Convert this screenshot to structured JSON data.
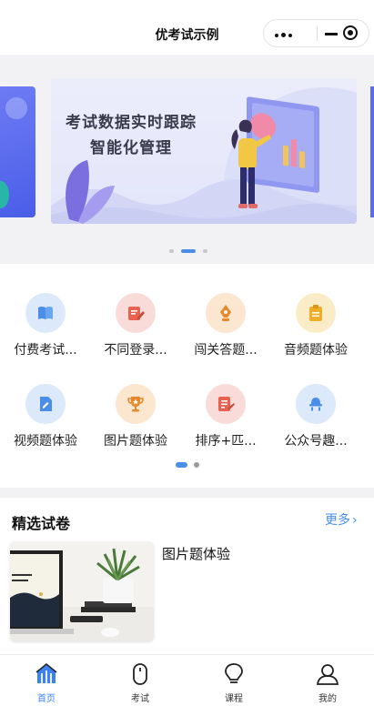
{
  "nav": {
    "title": "优考试示例"
  },
  "banner": {
    "line1": "考试数据实时跟踪",
    "line2": "智能化管理",
    "slides": 3,
    "active_slide": 1
  },
  "features": [
    {
      "label": "付费考试...",
      "icon": "book-icon",
      "color": "#dbe9fb",
      "accent": "#4a8ee8"
    },
    {
      "label": "不同登录...",
      "icon": "edit-icon",
      "color": "#f9dcda",
      "accent": "#e8624f"
    },
    {
      "label": "闯关答题...",
      "icon": "pen-nib-icon",
      "color": "#fbe6cf",
      "accent": "#e48a2b"
    },
    {
      "label": "音频题体验",
      "icon": "clipboard-icon",
      "color": "#fbecc8",
      "accent": "#efae28"
    },
    {
      "label": "视频题体验",
      "icon": "document-icon",
      "color": "#dbe9fb",
      "accent": "#4a8ee8"
    },
    {
      "label": "图片题体验",
      "icon": "trophy-icon",
      "color": "#fbe6cf",
      "accent": "#e48a2b"
    },
    {
      "label": "排序+匹...",
      "icon": "sort-icon",
      "color": "#f9dcda",
      "accent": "#e8624f"
    },
    {
      "label": "公众号趣...",
      "icon": "lamp-icon",
      "color": "#dbe9fb",
      "accent": "#4a8ee8"
    }
  ],
  "feature_pages": {
    "count": 2,
    "active": 0
  },
  "featured": {
    "title": "精选试卷",
    "more": "更多",
    "papers": [
      {
        "title": "图片题体验"
      }
    ]
  },
  "tabs": [
    {
      "label": "首页",
      "icon": "home-icon",
      "active": true
    },
    {
      "label": "考试",
      "icon": "mouse-icon",
      "active": false
    },
    {
      "label": "课程",
      "icon": "bulb-icon",
      "active": false
    },
    {
      "label": "我的",
      "icon": "user-icon",
      "active": false
    }
  ],
  "colors": {
    "accent": "#3b82f6",
    "more_link": "#4a8ee8"
  }
}
